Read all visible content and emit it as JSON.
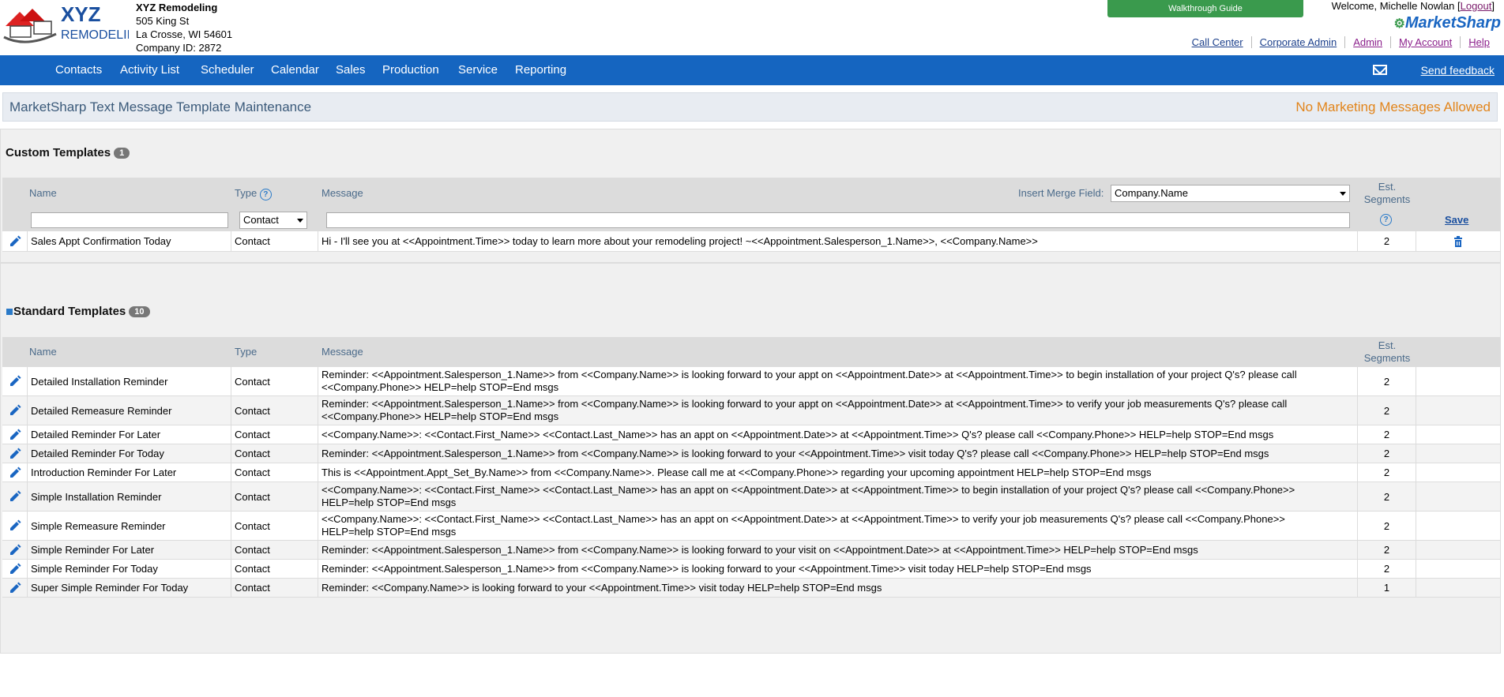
{
  "company": {
    "logo_top": "XYZ",
    "logo_bottom": "REMODELING",
    "name": "XYZ Remodeling",
    "address1": "505 King St",
    "address2": "La Crosse, WI 54601",
    "company_id": "Company ID: 2872"
  },
  "header": {
    "walkthrough": "Walkthrough Guide",
    "welcome": "Welcome, Michelle Nowlan [",
    "logout": "Logout",
    "welcome_end": "]",
    "brand": "MarketSharp",
    "links": [
      "Call Center",
      "Corporate Admin",
      "Admin",
      "My Account",
      "Help"
    ]
  },
  "nav": {
    "items": [
      "Contacts",
      "Activity List",
      "Scheduler",
      "Calendar",
      "Sales",
      "Production",
      "Service",
      "Reporting"
    ],
    "feedback": "Send feedback"
  },
  "page": {
    "title": "MarketSharp Text Message Template Maintenance",
    "notice": "No Marketing Messages Allowed"
  },
  "custom": {
    "heading": "Custom Templates",
    "count": "1",
    "col_name": "Name",
    "col_type": "Type",
    "col_message": "Message",
    "merge_label": "Insert Merge Field:",
    "merge_value": "Company.Name",
    "col_est": "Est.",
    "col_segments": "Segments",
    "type_select": "Contact",
    "save": "Save",
    "rows": [
      {
        "name": "Sales Appt Confirmation Today",
        "type": "Contact",
        "message": "Hi - I'll see you at <<Appointment.Time>> today to learn more about your remodeling project! ~<<Appointment.Salesperson_1.Name>>, <<Company.Name>>",
        "segments": "2"
      }
    ]
  },
  "standard": {
    "heading": "Standard Templates",
    "count": "10",
    "col_name": "Name",
    "col_type": "Type",
    "col_message": "Message",
    "col_est": "Est.",
    "col_segments": "Segments",
    "rows": [
      {
        "name": "Detailed Installation Reminder",
        "type": "Contact",
        "message": "Reminder: <<Appointment.Salesperson_1.Name>> from <<Company.Name>> is looking forward to your appt on <<Appointment.Date>> at <<Appointment.Time>> to begin installation of your project Q's? please call <<Company.Phone>> HELP=help STOP=End msgs",
        "segments": "2"
      },
      {
        "name": "Detailed Remeasure Reminder",
        "type": "Contact",
        "message": "Reminder: <<Appointment.Salesperson_1.Name>> from <<Company.Name>> is looking forward to your appt on <<Appointment.Date>> at <<Appointment.Time>> to verify your job measurements Q's? please call <<Company.Phone>> HELP=help STOP=End msgs",
        "segments": "2"
      },
      {
        "name": "Detailed Reminder For Later",
        "type": "Contact",
        "message": "<<Company.Name>>: <<Contact.First_Name>> <<Contact.Last_Name>> has an appt on <<Appointment.Date>> at <<Appointment.Time>> Q's? please call <<Company.Phone>> HELP=help STOP=End msgs",
        "segments": "2"
      },
      {
        "name": "Detailed Reminder For Today",
        "type": "Contact",
        "message": "Reminder: <<Appointment.Salesperson_1.Name>> from <<Company.Name>> is looking forward to your <<Appointment.Time>> visit today Q's? please call <<Company.Phone>> HELP=help STOP=End msgs",
        "segments": "2"
      },
      {
        "name": "Introduction Reminder For Later",
        "type": "Contact",
        "message": "This is <<Appointment.Appt_Set_By.Name>> from <<Company.Name>>. Please call me at <<Company.Phone>> regarding your upcoming appointment HELP=help STOP=End msgs",
        "segments": "2"
      },
      {
        "name": "Simple Installation Reminder",
        "type": "Contact",
        "message": "<<Company.Name>>: <<Contact.First_Name>> <<Contact.Last_Name>> has an appt on <<Appointment.Date>> at <<Appointment.Time>> to begin installation of your project Q's? please call <<Company.Phone>> HELP=help STOP=End msgs",
        "segments": "2"
      },
      {
        "name": "Simple Remeasure Reminder",
        "type": "Contact",
        "message": "<<Company.Name>>: <<Contact.First_Name>> <<Contact.Last_Name>> has an appt on <<Appointment.Date>> at <<Appointment.Time>> to verify your job measurements Q's? please call <<Company.Phone>> HELP=help STOP=End msgs",
        "segments": "2"
      },
      {
        "name": "Simple Reminder For Later",
        "type": "Contact",
        "message": "Reminder: <<Appointment.Salesperson_1.Name>> from <<Company.Name>> is looking forward to your visit on <<Appointment.Date>> at <<Appointment.Time>> HELP=help STOP=End msgs",
        "segments": "2"
      },
      {
        "name": "Simple Reminder For Today",
        "type": "Contact",
        "message": "Reminder: <<Appointment.Salesperson_1.Name>> from <<Company.Name>> is looking forward to your <<Appointment.Time>> visit today HELP=help STOP=End msgs",
        "segments": "2"
      },
      {
        "name": "Super Simple Reminder For Today",
        "type": "Contact",
        "message": "Reminder: <<Company.Name>> is looking forward to your <<Appointment.Time>> visit today HELP=help STOP=End msgs",
        "segments": "1"
      }
    ]
  }
}
